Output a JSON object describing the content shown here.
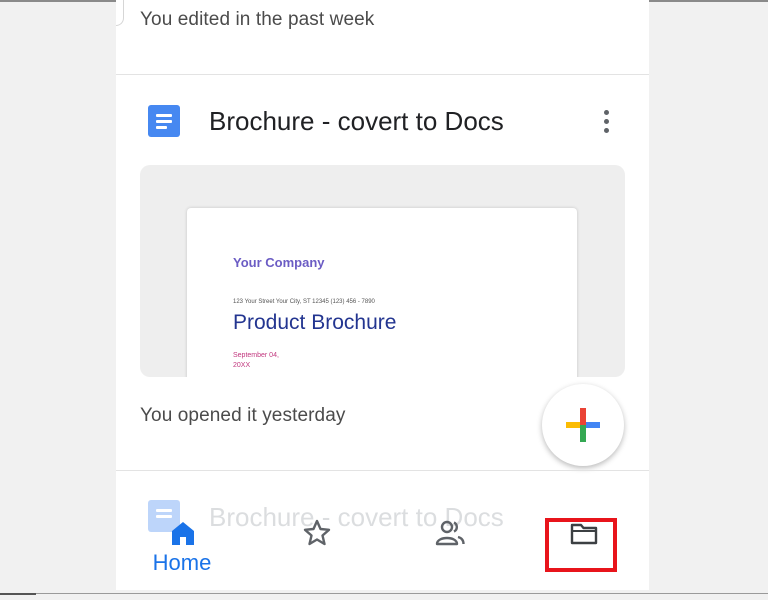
{
  "feed": {
    "previous_meta": "You edited in the past week",
    "file": {
      "title": "Brochure - covert to Docs",
      "icon": "google-docs-icon",
      "meta": "You opened it yesterday",
      "preview": {
        "company": "Your Company",
        "address": "123 Your Street Your City, ST 12345 (123) 456 - 7890",
        "title": "Product Brochure",
        "date": "September 04, 20XX"
      }
    },
    "next_file": {
      "title": "Brochure - covert to Docs"
    }
  },
  "fab": {
    "icon": "plus-icon"
  },
  "bottom_nav": {
    "items": [
      {
        "label": "Home",
        "icon": "home-icon",
        "active": true
      },
      {
        "label": "",
        "icon": "star-icon",
        "active": false
      },
      {
        "label": "",
        "icon": "people-icon",
        "active": false
      },
      {
        "label": "",
        "icon": "folder-icon",
        "active": false
      }
    ]
  },
  "colors": {
    "accent": "#1a73e8",
    "doc_blue": "#4688f1",
    "highlight": "#e8141b"
  }
}
